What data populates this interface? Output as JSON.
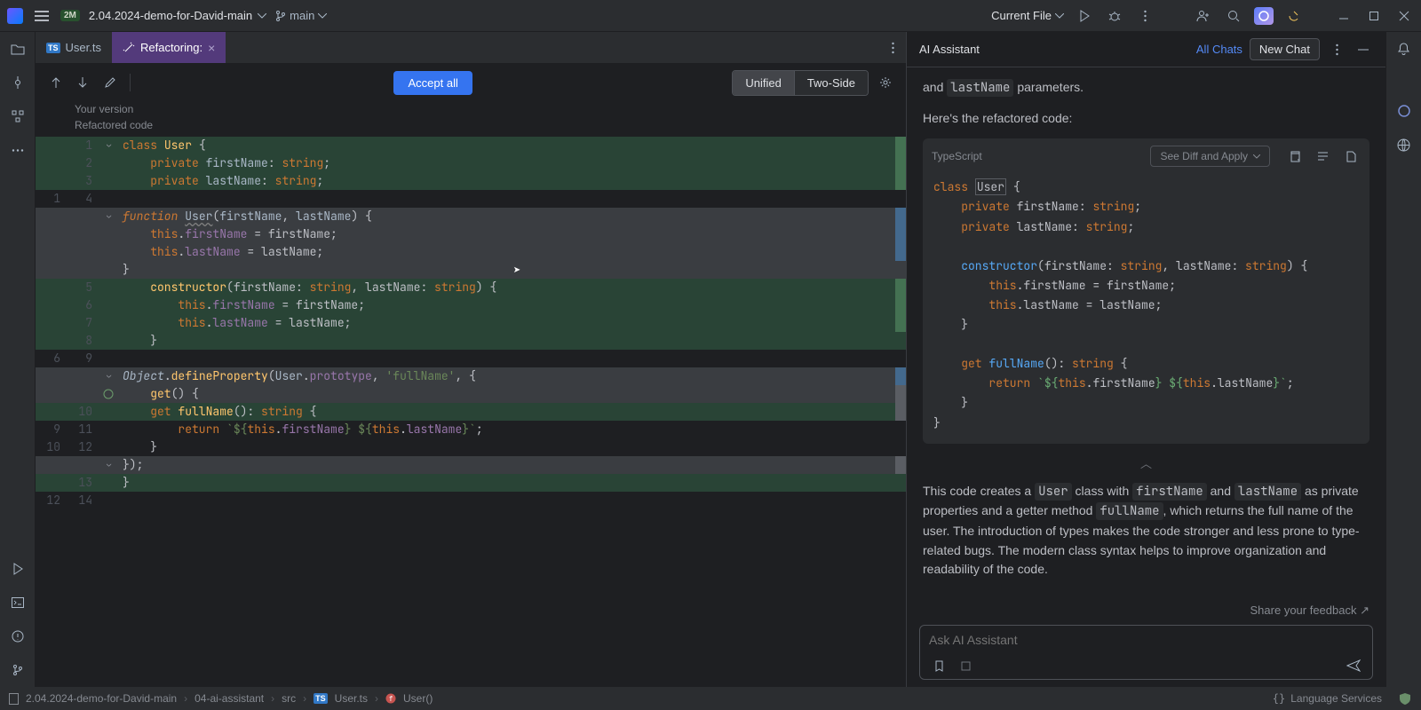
{
  "topbar": {
    "project_badge": "2M",
    "project_name": "2.04.2024-demo-for-David-main",
    "branch": "main",
    "current_file": "Current File"
  },
  "tabs": {
    "file_tab": "User.ts",
    "refactor_tab": "Refactoring:"
  },
  "diff": {
    "accept_all": "Accept all",
    "unified": "Unified",
    "two_side": "Two-Side",
    "your_version": "Your version",
    "refactored_code": "Refactored code"
  },
  "code": {
    "l1a": "1",
    "l1": "class User {",
    "l2a": "2",
    "l2": "    private firstName: string;",
    "l3a": "3",
    "l3": "    private lastName: string;",
    "l4l": "1",
    "l4r": "4",
    "l5": "function User(firstName, lastName) {",
    "l6": "    this.firstName = firstName;",
    "l7": "    this.lastName = lastName;",
    "l8": "}",
    "l9a": "5",
    "l9": "    constructor(firstName: string, lastName: string) {",
    "l10a": "6",
    "l10": "        this.firstName = firstName;",
    "l11a": "7",
    "l11": "        this.lastName = lastName;",
    "l12a": "8",
    "l12": "    }",
    "l13l": "6",
    "l13r": "9",
    "l14": "Object.defineProperty(User.prototype, 'fullName', {",
    "l15": "    get() {",
    "l16a": "10",
    "l16": "    get fullName(): string {",
    "l17l": "9",
    "l17r": "11",
    "l17": "        return `${this.firstName} ${this.lastName}`;",
    "l18l": "10",
    "l18r": "12",
    "l18": "    }",
    "l19": "});",
    "l20a": "13",
    "l20": "}",
    "l21l": "12",
    "l21r": "14"
  },
  "ai": {
    "title": "AI Assistant",
    "all_chats": "All Chats",
    "new_chat": "New Chat",
    "msg_top": "and lastName parameters.",
    "msg_intro": "Here's the refactored code:",
    "code_lang": "TypeScript",
    "see_diff": "See Diff and Apply",
    "snippet": "class User {\n    private firstName: string;\n    private lastName: string;\n\n    constructor(firstName: string, lastName: string) {\n        this.firstName = firstName;\n        this.lastName = lastName;\n    }\n\n    get fullName(): string {\n        return `${this.firstName} ${this.lastName}`;\n    }\n}",
    "explain": "This code creates a User class with firstName and lastName as private properties and a getter method fullName, which returns the full name of the user. The introduction of types makes the code stronger and less prone to type-related bugs. The modern class syntax helps to improve organization and readability of the code.",
    "feedback": "Share your feedback",
    "input_placeholder": "Ask AI Assistant"
  },
  "status": {
    "proj": "2.04.2024-demo-for-David-main",
    "dir": "04-ai-assistant",
    "src": "src",
    "file": "User.ts",
    "symbol": "User()",
    "lang": "Language Services"
  }
}
